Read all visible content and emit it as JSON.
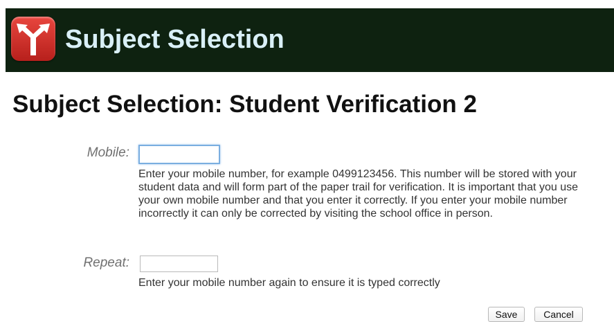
{
  "header": {
    "app_title": "Subject Selection",
    "logo_icon": "branching-arrows-icon",
    "background_color": "#0e2210",
    "logo_color": "#d3302a"
  },
  "page": {
    "title": "Subject Selection: Student Verification 2"
  },
  "form": {
    "mobile": {
      "label": "Mobile:",
      "value": "",
      "help": "Enter your mobile number, for example 0499123456. This number will be stored with your student data and will form part of the paper trail for verification. It is important that you use your own mobile number and that you enter it correctly. If you enter your mobile number incorrectly it can only be corrected by visiting the school office in person."
    },
    "repeat": {
      "label": "Repeat:",
      "value": "",
      "help": "Enter your mobile number again to ensure it is typed correctly"
    }
  },
  "actions": {
    "save_label": "Save",
    "cancel_label": "Cancel"
  }
}
